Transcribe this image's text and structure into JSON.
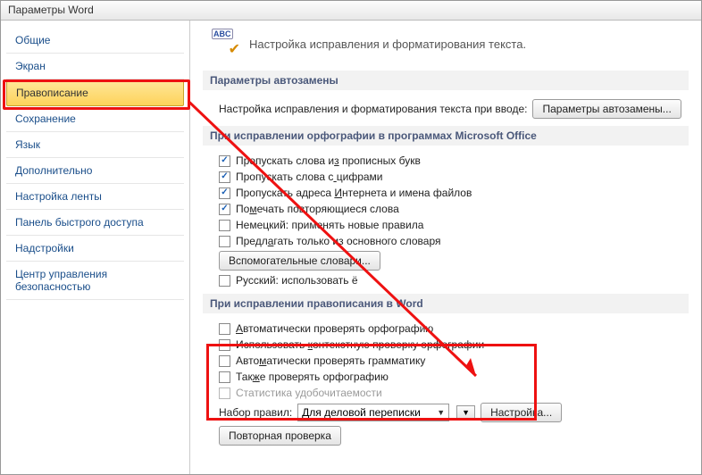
{
  "window": {
    "title": "Параметры Word"
  },
  "sidebar": {
    "items": [
      {
        "label": "Общие"
      },
      {
        "label": "Экран"
      },
      {
        "label": "Правописание"
      },
      {
        "label": "Сохранение"
      },
      {
        "label": "Язык"
      },
      {
        "label": "Дополнительно"
      },
      {
        "label": "Настройка ленты"
      },
      {
        "label": "Панель быстрого доступа"
      },
      {
        "label": "Надстройки"
      },
      {
        "label": "Центр управления безопасностью"
      }
    ],
    "selected_index": 2
  },
  "header": {
    "text": "Настройка исправления и форматирования текста."
  },
  "sections": {
    "autozamena": {
      "title": "Параметры автозамены",
      "desc": "Настройка исправления и форматирования текста при вводе:",
      "button": "Параметры автозамены..."
    },
    "office": {
      "title": "При исправлении орфографии в программах Microsoft Office",
      "checks": [
        {
          "checked": true,
          "label": "Пропускать слова из прописных букв",
          "ul": 18
        },
        {
          "checked": true,
          "label": "Пропускать слова с цифрами",
          "ul": 18
        },
        {
          "checked": true,
          "label": "Пропускать адреса Интернета и имена файлов",
          "ul": 18
        },
        {
          "checked": true,
          "label": "Помечать повторяющиеся слова",
          "ul": 2
        },
        {
          "checked": false,
          "label": "Немецкий: применять новые правила"
        },
        {
          "checked": false,
          "label": "Предлагать только из основного словаря",
          "ul": 5
        }
      ],
      "dict_button": "Вспомогательные словари...",
      "russian": {
        "checked": false,
        "label": "Русский: использовать ё",
        "ul": 0
      }
    },
    "word": {
      "title": "При исправлении правописания в Word",
      "checks": [
        {
          "checked": false,
          "label": "Автоматически проверять орфографию",
          "ul": 0
        },
        {
          "checked": false,
          "label": "Использовать контекстную проверку орфографии",
          "ul": 13
        },
        {
          "checked": false,
          "label": "Автоматически проверять грамматику",
          "ul": 4
        },
        {
          "checked": false,
          "label": "Также проверять орфографию",
          "ul": 3
        }
      ],
      "stats": {
        "checked": false,
        "label": "Статистика удобочитаемости"
      },
      "rules_label": "Набор правил:",
      "rules_value": "Для деловой переписки",
      "settings_btn": "Настройка...",
      "recheck_btn": "Повторная проверка"
    }
  }
}
